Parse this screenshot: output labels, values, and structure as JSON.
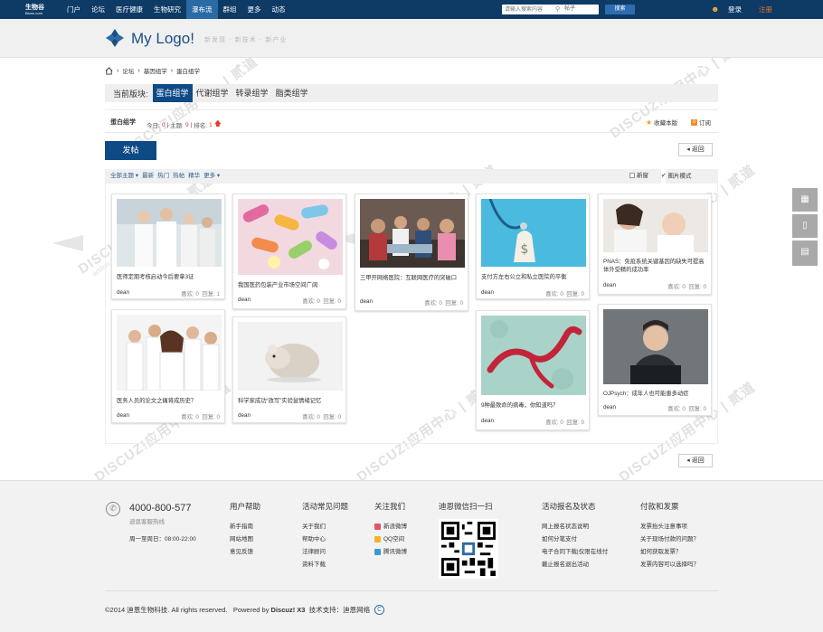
{
  "topbar": {
    "brand": "生物谷",
    "brand_sub": "Bioon.com",
    "nav": [
      "门户",
      "论坛",
      "医疗健康",
      "生物研究",
      "瀑布流",
      "群组",
      "更多",
      "动态"
    ],
    "active_nav": "瀑布流",
    "search_placeholder": "请输入搜索内容",
    "search_scope": "帖子",
    "search_button": "搜索",
    "login": "登录",
    "register": "注册"
  },
  "header": {
    "logo_text": "My Logo!",
    "slogan": "新发现 · 新技术 · 新产业"
  },
  "breadcrumb": [
    "论坛",
    "基因组学",
    "蛋白组学"
  ],
  "forum_bar": {
    "label": "当前版块:",
    "tabs": [
      "蛋白组学",
      "代谢组学",
      "转录组学",
      "脂类组学"
    ],
    "active": "蛋白组学"
  },
  "forum_info": {
    "name": "蛋白组学",
    "today_label": "今日:",
    "today": "0",
    "topics_label": "主题:",
    "topics": "9",
    "rank_label": "排名:",
    "rank": "1",
    "favorite": "收藏本版",
    "rss": "订阅"
  },
  "actions": {
    "post": "发帖",
    "back": "返回"
  },
  "filter": {
    "all": "全部主题",
    "items": [
      "最新",
      "热门",
      "热帖",
      "精华",
      "更多"
    ],
    "new_window": "新窗",
    "image_mode": "图片模式"
  },
  "cards": [
    {
      "title": "医师定期考核启动今后要拿3证",
      "author": "dean",
      "likes": "喜欢: 0",
      "replies": "回复: 1"
    },
    {
      "title": "我国医药包装产业市场空间广阔",
      "author": "dean",
      "likes": "喜欢: 0",
      "replies": "回复: 0"
    },
    {
      "title": "三甲开网络医院：互联网医疗的突破口",
      "author": "dean",
      "likes": "喜欢: 0",
      "replies": "回复: 0"
    },
    {
      "title": "支付方左右公立和私立医院的平衡",
      "author": "dean",
      "likes": "喜欢: 0",
      "replies": "回复: 0"
    },
    {
      "title": "PNAS：免疫系统关键基因的缺失可提高体外受精的成功率",
      "author": "dean",
      "likes": "喜欢: 0",
      "replies": "回复: 0"
    },
    {
      "title": "医务人员的论文之痛将成历史？",
      "author": "dean",
      "likes": "喜欢: 0",
      "replies": "回复: 0"
    },
    {
      "title": "科学家成功“改写”实验鼠情绪记忆",
      "author": "dean",
      "likes": "喜欢: 0",
      "replies": "回复: 0"
    },
    {
      "title": "9种最致命的病毒，你知道吗？",
      "author": "dean",
      "likes": "喜欢: 0",
      "replies": "回复: 0"
    },
    {
      "title": "OJPsych：成年人也可能患多动症",
      "author": "dean",
      "likes": "喜欢: 0",
      "replies": "回复: 0"
    }
  ],
  "footer": {
    "phone": "4000-800-577",
    "phone_sub": "迪恩客服热线",
    "hours": "周一至周日：08:00-22:00",
    "columns": [
      {
        "title": "用户帮助",
        "items": [
          "新手指南",
          "网站地图",
          "意见反馈"
        ]
      },
      {
        "title": "活动常见问题",
        "items": [
          "关于我们",
          "帮助中心",
          "法律顾问",
          "资料下载"
        ]
      },
      {
        "title": "关注我们",
        "items": [
          "新浪微博",
          "QQ空间",
          "腾讯微博"
        ]
      },
      {
        "title": "迪恩微信扫一扫",
        "items": []
      },
      {
        "title": "活动报名及状态",
        "items": [
          "网上报名状态说明",
          "如何分笔支付",
          "电子合同下载|仅限在线付",
          "戴止报名退出活动"
        ]
      },
      {
        "title": "付款和发票",
        "items": [
          "发票抬头注意事项",
          "关于现场付款的问题？",
          "如何获取发票？",
          "发票内容可以选择吗？"
        ]
      }
    ],
    "copyright": "©2014  迪恩生物科技. All rights reserved.",
    "powered_prefix": "Powered by",
    "powered_brand": "Discuz! X3",
    "tech_support": "技术支持：迪恩网络"
  },
  "watermark": {
    "text": "DISCUZ!应用中心 | 贰道",
    "sub": "addon.dismall.com"
  },
  "colors": {
    "topbar": "#0e3a66",
    "primary": "#0e4a86",
    "accent_red": "#e03c31",
    "register": "#f0742b"
  }
}
